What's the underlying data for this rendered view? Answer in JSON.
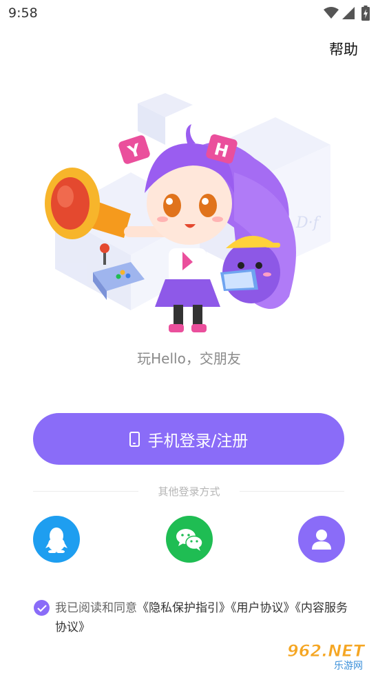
{
  "status_bar": {
    "time": "9:58"
  },
  "header": {
    "help_label": "帮助"
  },
  "illustration": {
    "hat_letters": [
      "Y",
      "H"
    ],
    "badge_text": "D·f"
  },
  "slogan": "玩Hello，交朋友",
  "login_button": {
    "label": "手机登录/注册"
  },
  "divider_text": "其他登录方式",
  "social": [
    {
      "name": "qq",
      "icon": "qq-penguin-icon",
      "color": "#1e9ef0"
    },
    {
      "name": "wechat",
      "icon": "wechat-icon",
      "color": "#1fbd53"
    },
    {
      "name": "account",
      "icon": "user-icon",
      "color": "#8a6cf8"
    }
  ],
  "agreement": {
    "prefix": "我已阅读和同意",
    "privacy": "《隐私保护指引》",
    "user": "《用户协议》",
    "content": "《内容服务协议》"
  },
  "watermark": {
    "logo": "962.NET",
    "sub": "乐游网"
  },
  "colors": {
    "accent": "#8a6cf8",
    "qq": "#1e9ef0",
    "wechat": "#1fbd53"
  }
}
